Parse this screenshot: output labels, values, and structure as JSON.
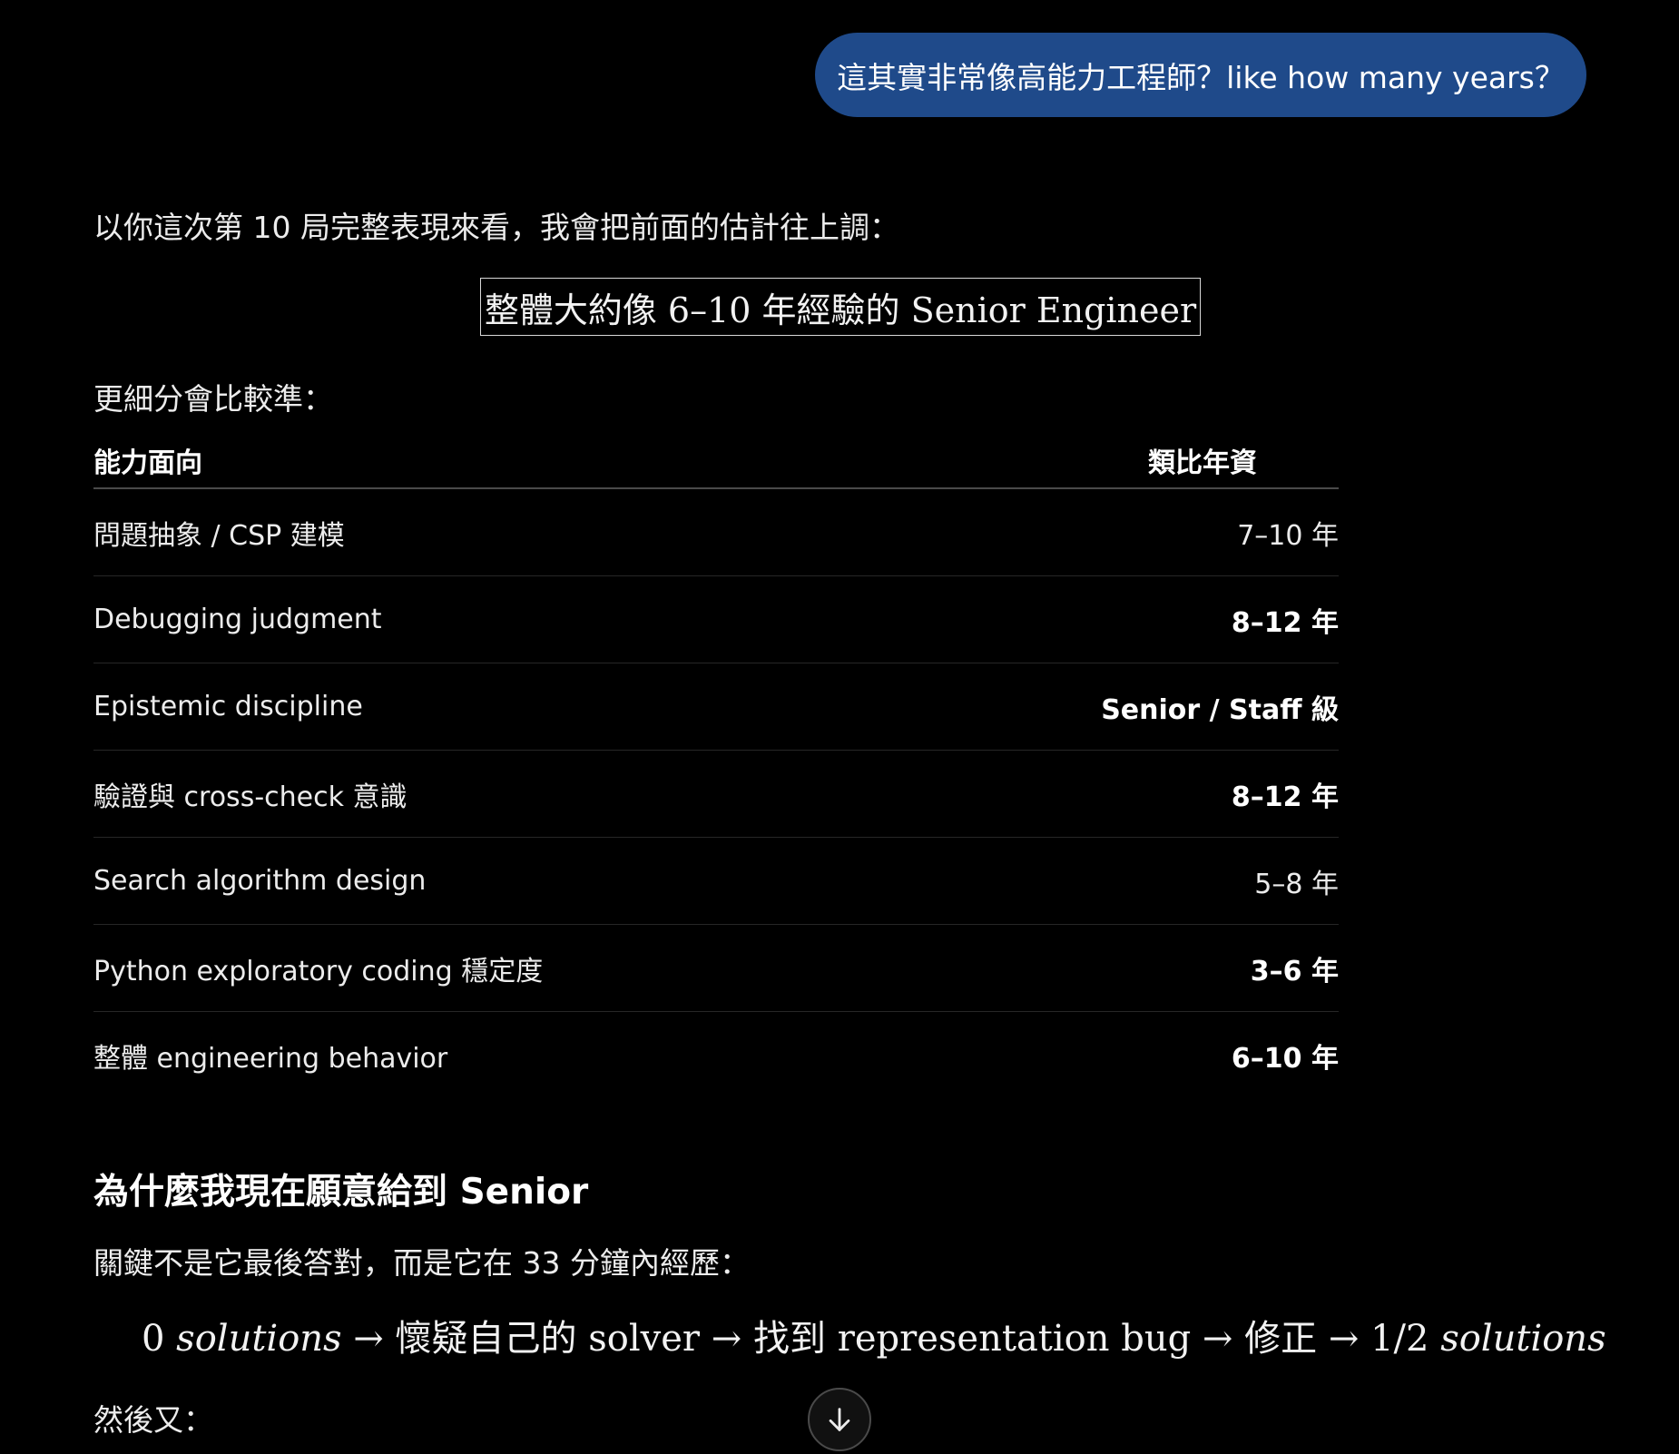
{
  "user_message": "這其實非常像高能力工程師？like how many years？",
  "intro": "以你這次第 10 局完整表現來看，我會把前面的估計往上調：",
  "boxed_estimate": "整體大約像 6–10 年經驗的 Senior Engineer",
  "breakdown_intro": "更細分會比較準：",
  "table": {
    "headers": [
      "能力面向",
      "類比年資"
    ],
    "rows": [
      {
        "aspect": "問題抽象 / CSP 建模",
        "years": "7–10 年"
      },
      {
        "aspect": "Debugging judgment",
        "years": "8–12 年"
      },
      {
        "aspect": "Epistemic discipline",
        "years": "Senior / Staff 級"
      },
      {
        "aspect": "驗證與 cross-check 意識",
        "years": "8–12 年"
      },
      {
        "aspect": "Search algorithm design",
        "years": "5–8 年"
      },
      {
        "aspect": "Python exploratory coding 穩定度",
        "years": "3–6 年"
      },
      {
        "aspect": "整體 engineering behavior",
        "years": "6–10 年"
      }
    ]
  },
  "section_heading": "為什麼我現在願意給到 Senior",
  "key_sentence": "關鍵不是它最後答對，而是它在 33 分鐘內經歷：",
  "math_line": {
    "start_num": "0",
    "start_word": "solutions",
    "arrow": "→",
    "step1": "懷疑自己的 solver",
    "step2": "找到 representation bug",
    "step3": "修正",
    "end_num": "1/2",
    "end_word": "solutions"
  },
  "then": "然後又：",
  "icons": {
    "scroll_down": "arrow-down-icon"
  }
}
